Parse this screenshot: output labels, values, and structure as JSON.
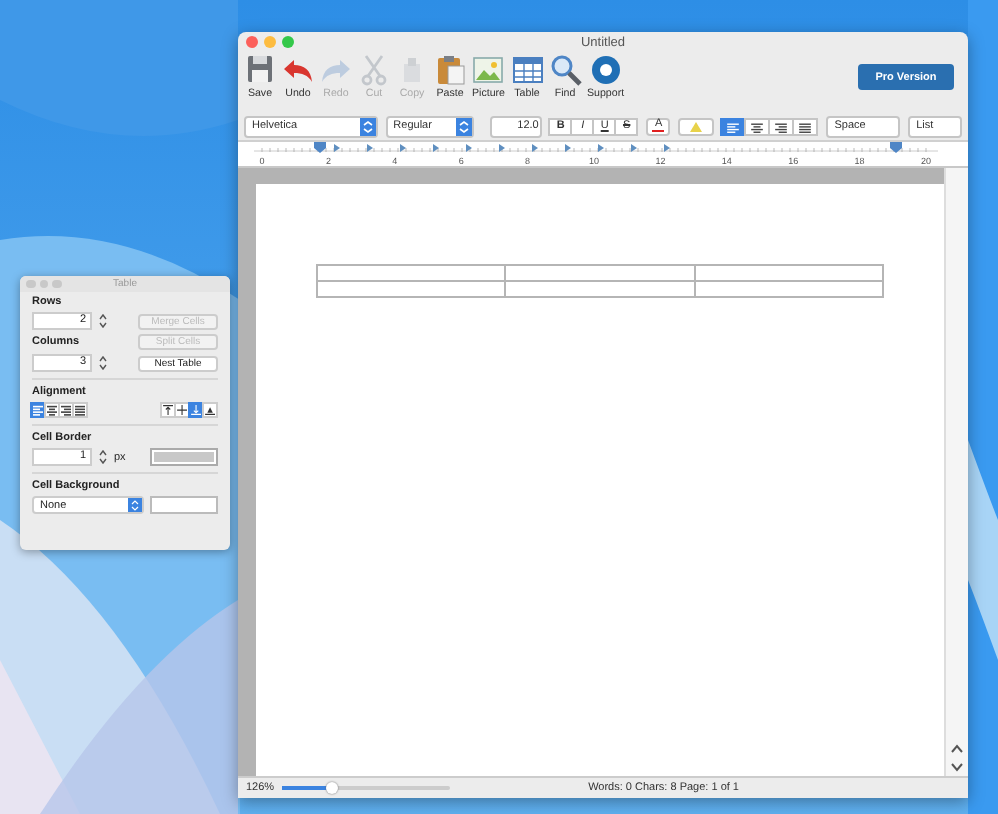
{
  "main_window": {
    "title": "Untitled",
    "toolbar": [
      {
        "kind": "save",
        "label": "Save",
        "disabled": false
      },
      {
        "kind": "undo",
        "label": "Undo",
        "disabled": false
      },
      {
        "kind": "redo",
        "label": "Redo",
        "disabled": true
      },
      {
        "kind": "cut",
        "label": "Cut",
        "disabled": true
      },
      {
        "kind": "copy",
        "label": "Copy",
        "disabled": true
      },
      {
        "kind": "paste",
        "label": "Paste",
        "disabled": false
      },
      {
        "kind": "picture",
        "label": "Picture",
        "disabled": false
      },
      {
        "kind": "table",
        "label": "Table",
        "disabled": false
      },
      {
        "kind": "find",
        "label": "Find",
        "disabled": false
      },
      {
        "kind": "support",
        "label": "Support",
        "disabled": false
      }
    ],
    "pro_button": "Pro Version",
    "format_bar": {
      "font": "Helvetica",
      "style": "Regular",
      "size": "12.0",
      "styles": [
        {
          "kind": "bold",
          "label": "B"
        },
        {
          "kind": "italic",
          "label": "I"
        },
        {
          "kind": "underline",
          "label": "U"
        },
        {
          "kind": "strike",
          "label": "S"
        }
      ],
      "text_color": {
        "label": "A",
        "color": "#e02020"
      },
      "alignment": [
        {
          "kind": "left",
          "selected": true
        },
        {
          "kind": "center",
          "selected": false
        },
        {
          "kind": "right",
          "selected": false
        },
        {
          "kind": "justify",
          "selected": false
        }
      ],
      "spacing": "Space",
      "list": "List"
    },
    "ruler": {
      "labels": [
        "0",
        "2",
        "4",
        "6",
        "8",
        "10",
        "12",
        "14",
        "16",
        "18",
        "20"
      ]
    },
    "document": {
      "table": {
        "rows": [
          {
            "cells": [
              {
                "kind": "empty"
              },
              {
                "kind": "empty"
              },
              {
                "kind": "empty"
              }
            ]
          },
          {
            "cells": [
              {
                "kind": "empty"
              },
              {
                "kind": "empty"
              },
              {
                "kind": "empty"
              }
            ]
          }
        ]
      }
    },
    "status_bar": {
      "zoom": "126%",
      "zoom_slider": {
        "level": 0.3
      },
      "counts": "Words: 0  Chars: 8  Page: 1 of 1"
    }
  },
  "table_panel": {
    "title": "Table",
    "rows": {
      "label": "Rows",
      "value": "2"
    },
    "columns": {
      "label": "Columns",
      "value": "3"
    },
    "buttons": [
      {
        "label": "Merge Cells",
        "disabled": true
      },
      {
        "label": "Split Cells",
        "disabled": true
      },
      {
        "label": "Nest Table",
        "disabled": false
      }
    ],
    "alignment": {
      "label": "Alignment",
      "horizontal": [
        {
          "kind": "left",
          "selected": true
        },
        {
          "kind": "center",
          "selected": false
        },
        {
          "kind": "right",
          "selected": false
        },
        {
          "kind": "justify",
          "selected": false
        }
      ],
      "vertical": [
        {
          "kind": "top",
          "selected": false
        },
        {
          "kind": "middle",
          "selected": false
        },
        {
          "kind": "bottom",
          "selected": true
        },
        {
          "kind": "baseline",
          "selected": false
        }
      ]
    },
    "cell_border": {
      "label": "Cell Border",
      "value": "1",
      "unit": "px"
    },
    "cell_background": {
      "label": "Cell Background",
      "value": "None"
    }
  }
}
